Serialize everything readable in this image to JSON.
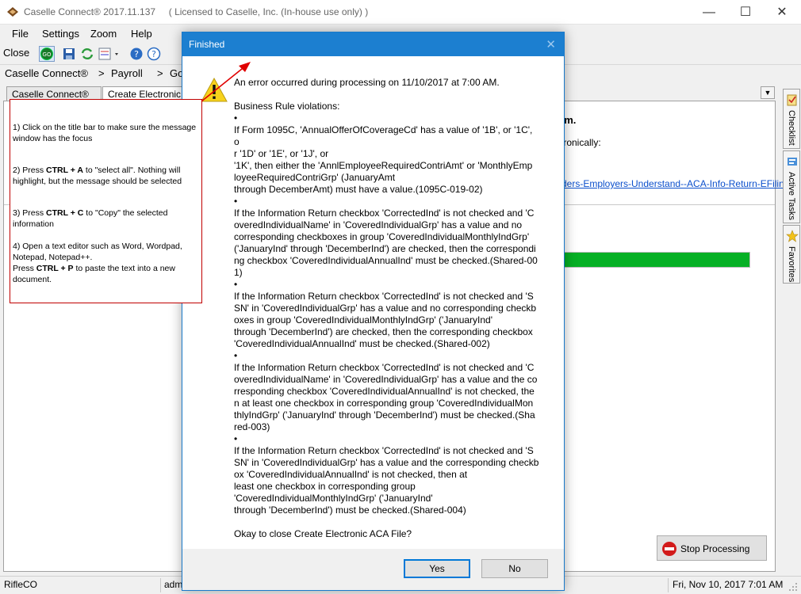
{
  "window": {
    "title": "Caselle Connect® 2017.11.137     ( Licensed to Caselle, Inc. (In-house use only) )",
    "minimize": "—",
    "maximize": "☐",
    "close": "✕"
  },
  "menu": [
    "File",
    "Settings",
    "Zoom",
    "Help"
  ],
  "toolbar": {
    "close_label": "Close"
  },
  "breadcrumb": [
    "Caselle Connect®",
    ">",
    "Payroll",
    ">",
    "Go"
  ],
  "tabs": [
    "Caselle Connect®",
    "Create Electronic A"
  ],
  "background": {
    "title_tail": "em.",
    "desc_tail": "tronically:",
    "link_tail": "ders-Employers-Understand--ACA-Info-Return-EFiling",
    "progress_percent": 100,
    "progress_color": "#06b025",
    "stop_button": "Stop Processing"
  },
  "side_tabs": [
    "Checklist",
    "Active Tasks",
    "Favorites"
  ],
  "status": {
    "org": "RifleCO",
    "user": "adm",
    "datetime": "Fri, Nov 10, 2017 7:01 AM"
  },
  "note": {
    "step1": "1)  Click on the title bar to make sure the message window has the focus",
    "step2_a": "2)  Press ",
    "step2_key": "CTRL + A",
    "step2_b": " to \"select all\".  Nothing will highlight, but the message should be selected",
    "step3_a": "3)  Press ",
    "step3_key": "CTRL + C",
    "step3_b": " to \"Copy\" the selected information",
    "step4_a": "4)  Open a text editor such as Word, Wordpad, Notepad, Notepad++.",
    "step4_b1": "Press ",
    "step4_key": "CTRL + P",
    "step4_b2": " to paste the text into a new document."
  },
  "dialog": {
    "title": "Finished",
    "close": "✕",
    "message": "An error occurred during processing on 11/10/2017 at 7:00 AM.\n\nBusiness Rule violations:\n•\nIf Form 1095C, 'AnnualOfferOfCoverageCd' has a value of '1B', or '1C', o\nr '1D' or '1E', or '1J', or\n'1K', then either the 'AnnlEmployeeRequiredContriAmt' or 'MonthlyEmp\nloyeeRequiredContriGrp' (JanuaryAmt\nthrough DecemberAmt) must have a value.(1095C-019-02)\n•\nIf the Information Return checkbox 'CorrectedInd' is not checked and 'C\noveredIndividualName' in 'CoveredIndividualGrp' has a value and no\ncorresponding checkboxes in group 'CoveredIndividualMonthlyIndGrp'\n('JanuaryInd' through 'DecemberInd') are checked, then the correspondi\nng checkbox 'CoveredIndividualAnnualInd' must be checked.(Shared-00\n1)\n•\nIf the Information Return checkbox 'CorrectedInd' is not checked and 'S\nSN' in 'CoveredIndividualGrp' has a value and no corresponding checkb\noxes in group 'CoveredIndividualMonthlyIndGrp' ('JanuaryInd'\nthrough 'DecemberInd') are checked, then the corresponding checkbox\n'CoveredIndividualAnnualInd' must be checked.(Shared-002)\n•\nIf the Information Return checkbox 'CorrectedInd' is not checked and 'C\noveredIndividualName' in 'CoveredIndividualGrp' has a value and the co\nrresponding checkbox 'CoveredIndividualAnnualInd' is not checked, the\nn at least one checkbox in corresponding group 'CoveredIndividualMon\nthlyIndGrp' ('JanuaryInd' through 'DecemberInd') must be checked.(Sha\nred-003)\n•\nIf the Information Return checkbox 'CorrectedInd' is not checked and 'S\nSN' in 'CoveredIndividualGrp' has a value and the corresponding checkb\nox 'CoveredIndividualAnnualInd' is not checked, then at\nleast one checkbox in corresponding group\n'CoveredIndividualMonthlyIndGrp' ('JanuaryInd'\nthrough 'DecemberInd') must be checked.(Shared-004)\n\nOkay to close Create Electronic ACA File?",
    "yes": "Yes",
    "no": "No"
  }
}
